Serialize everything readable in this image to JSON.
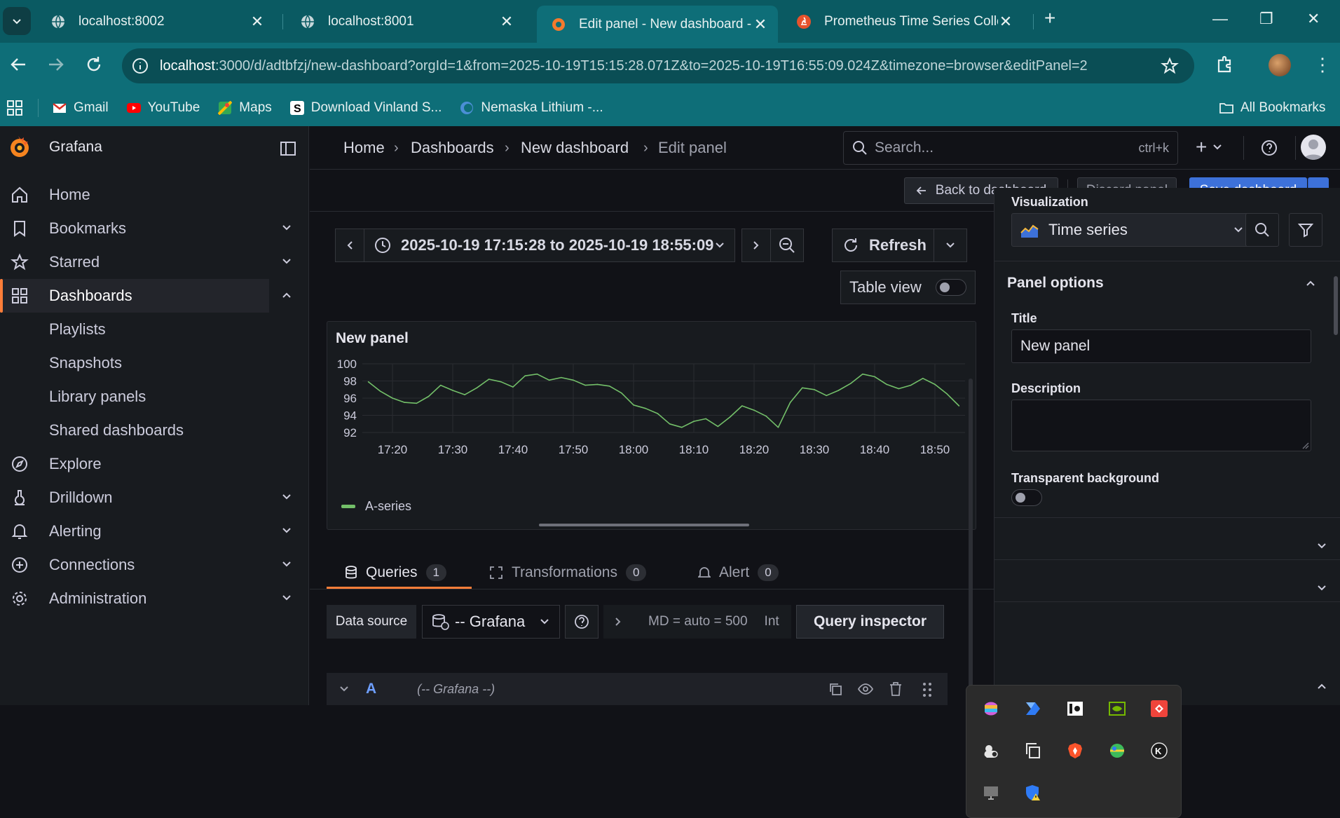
{
  "browser": {
    "tabs": [
      {
        "title": "localhost:8002",
        "active": false
      },
      {
        "title": "localhost:8001",
        "active": false
      },
      {
        "title": "Edit panel - New dashboard - Da",
        "active": true
      },
      {
        "title": "Prometheus Time Series Collecti",
        "active": false
      }
    ],
    "url_host": "localhost",
    "url_rest": ":3000/d/adtbfzj/new-dashboard?orgId=1&from=2025-10-19T15:15:28.071Z&to=2025-10-19T16:55:09.024Z&timezone=browser&editPanel=2",
    "bookmarks": [
      "Gmail",
      "YouTube",
      "Maps",
      "Download Vinland S...",
      "Nemaska Lithium -..."
    ],
    "all_bookmarks": "All Bookmarks"
  },
  "grafana": {
    "brand": "Grafana",
    "menu": [
      {
        "label": "Home",
        "icon": "home-icon",
        "chevron": false
      },
      {
        "label": "Bookmarks",
        "icon": "bookmark-icon",
        "chevron": true
      },
      {
        "label": "Starred",
        "icon": "star-icon",
        "chevron": true
      },
      {
        "label": "Dashboards",
        "icon": "dashboards-icon",
        "chevron": true,
        "active": true
      },
      {
        "label": "Playlists",
        "sub": true
      },
      {
        "label": "Snapshots",
        "sub": true
      },
      {
        "label": "Library panels",
        "sub": true
      },
      {
        "label": "Shared dashboards",
        "sub": true
      },
      {
        "label": "Explore",
        "icon": "compass-icon",
        "chevron": false
      },
      {
        "label": "Drilldown",
        "icon": "drilldown-icon",
        "chevron": true
      },
      {
        "label": "Alerting",
        "icon": "bell-icon",
        "chevron": true
      },
      {
        "label": "Connections",
        "icon": "connections-icon",
        "chevron": true
      },
      {
        "label": "Administration",
        "icon": "gear-icon",
        "chevron": true
      }
    ],
    "breadcrumbs": [
      "Home",
      "Dashboards",
      "New dashboard",
      "Edit panel"
    ],
    "search_placeholder": "Search...",
    "search_shortcut": "ctrl+k",
    "actions": {
      "back": "Back to dashboard",
      "discard": "Discard panel",
      "save": "Save dashboard"
    },
    "time_range": "2025-10-19 17:15:28 to 2025-10-19 18:55:09",
    "refresh": "Refresh",
    "table_view": "Table view",
    "panel_title": "New panel",
    "legend": "A-series",
    "query_tabs": [
      {
        "label": "Queries",
        "count": "1"
      },
      {
        "label": "Transformations",
        "count": "0"
      },
      {
        "label": "Alert",
        "count": "0"
      }
    ],
    "datasource_label": "Data source",
    "datasource_value": "-- Grafana",
    "query_options": "MD = auto = 500",
    "query_options_more": "Int",
    "query_inspector": "Query inspector",
    "query_row": {
      "letter": "A",
      "ds": "(-- Grafana --)"
    },
    "options": {
      "visualization_label": "Visualization",
      "visualization_value": "Time series",
      "panel_options": "Panel options",
      "title_label": "Title",
      "title_value": "New panel",
      "description_label": "Description",
      "transparent_label": "Transparent background"
    }
  },
  "chart_data": {
    "type": "line",
    "title": "New panel",
    "ylim": [
      92,
      100
    ],
    "yticks": [
      "100",
      "98",
      "96",
      "94",
      "92"
    ],
    "xticks": [
      "17:20",
      "17:30",
      "17:40",
      "17:50",
      "18:00",
      "18:10",
      "18:20",
      "18:30",
      "18:40",
      "18:50"
    ],
    "series": [
      {
        "name": "A-series",
        "color": "#73bf69",
        "x": [
          "17:16",
          "17:18",
          "17:20",
          "17:22",
          "17:24",
          "17:26",
          "17:28",
          "17:30",
          "17:32",
          "17:34",
          "17:36",
          "17:38",
          "17:40",
          "17:42",
          "17:44",
          "17:46",
          "17:48",
          "17:50",
          "17:52",
          "17:54",
          "17:56",
          "17:58",
          "18:00",
          "18:02",
          "18:04",
          "18:06",
          "18:08",
          "18:10",
          "18:12",
          "18:14",
          "18:16",
          "18:18",
          "18:20",
          "18:22",
          "18:24",
          "18:26",
          "18:28",
          "18:30",
          "18:32",
          "18:34",
          "18:36",
          "18:38",
          "18:40",
          "18:42",
          "18:44",
          "18:46",
          "18:48",
          "18:50",
          "18:52",
          "18:54"
        ],
        "values": [
          97.9,
          96.8,
          96.0,
          95.5,
          95.4,
          96.2,
          97.5,
          96.9,
          96.4,
          97.2,
          98.2,
          97.9,
          97.3,
          98.6,
          98.8,
          98.1,
          98.4,
          98.1,
          97.5,
          97.6,
          97.4,
          96.6,
          95.2,
          94.8,
          94.2,
          93.0,
          92.6,
          93.3,
          93.6,
          92.7,
          93.8,
          95.1,
          94.6,
          93.9,
          92.6,
          95.5,
          97.2,
          97.0,
          96.3,
          96.9,
          97.7,
          98.8,
          98.5,
          97.6,
          97.1,
          97.5,
          98.3,
          97.6,
          96.5,
          95.1
        ]
      }
    ]
  },
  "tray_icons": [
    "m365-icon",
    "power-automate-icon",
    "app-icon",
    "nvidia-icon",
    "anydesk-icon",
    "weather-icon",
    "copy-icon",
    "brave-icon",
    "network-icon",
    "sync-icon",
    "monitor-icon",
    "defender-warning-icon"
  ]
}
